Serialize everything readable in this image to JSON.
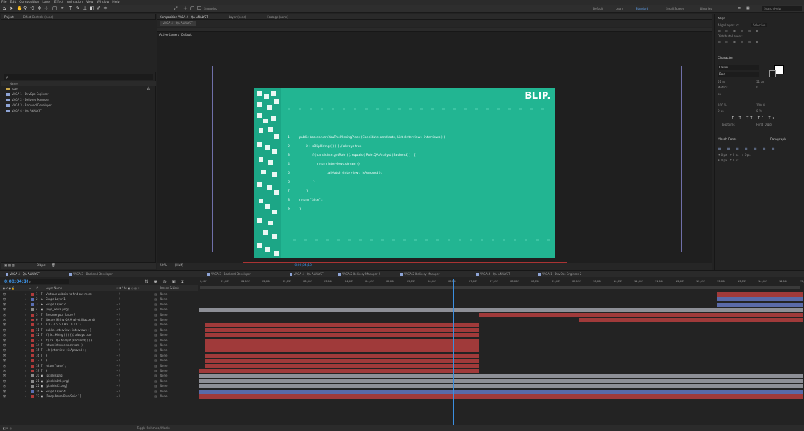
{
  "menu": [
    "File",
    "Edit",
    "Composition",
    "Layer",
    "Effect",
    "Animation",
    "View",
    "Window",
    "Help"
  ],
  "toolbar": {
    "snapping_label": "Snapping",
    "workspaces": [
      "Default",
      "Learn",
      "Standard",
      "Small Screen",
      "Libraries"
    ],
    "active_workspace": "Standard",
    "search_placeholder": "Search Help"
  },
  "project_panel": {
    "tabs": [
      "Project",
      "Effect Controls (none)"
    ],
    "search_placeholder": "ρ",
    "column_name": "Name",
    "items": [
      "logo",
      "VAGA 1 - DevOps Engineer",
      "VAGA 2 - Delivery Manager",
      "VAGA 3 - Backend Developer",
      "VAGA 4 - QA ANALYST"
    ],
    "footer_bpc": "8 bpc"
  },
  "composition_panel": {
    "tab_label": "Composition VAGA 4 - QA ANALYST",
    "layer_tab": "Layer (none)",
    "footage_tab": "Footage (none)",
    "sub_tab": "VAGA 4 - QA ANALYST",
    "active_camera": "Active Camera (Default)",
    "footer": {
      "zoom": "50%",
      "resolution": "(Half)",
      "timecode": "0;00;04;10"
    },
    "artwork": {
      "brand": "BLIP.",
      "background": "#22b592",
      "code_lines": [
        "public boolean areYouTheMissingPiece (Candidate candidate, List<Interview> interviews ) {",
        "if ( isBlipHiring ( ) )  { // always true",
        "if ( candidate.getRole ( ). equals ( Role.QA Analyst (Backend) ) ) {",
        "return interviews.stream ()",
        ".allMatch (Interview :: isAproved ) ;",
        "}",
        "}",
        "return \"false\" ;",
        "}"
      ],
      "line_numbers": [
        "1",
        "2",
        "3",
        "4",
        "5",
        "6",
        "7",
        "8",
        "9"
      ]
    }
  },
  "right_panels": {
    "align_title": "Align",
    "align_to_label": "Align Layers to:",
    "align_to_value": "Selection",
    "distribute_label": "Distribute Layers:",
    "character_title": "Character",
    "font_name": "Calibri",
    "font_style": "Bold",
    "font_size": "51 px",
    "leading": "51 px",
    "kerning": "Metrics",
    "tracking": "0",
    "stroke": "px",
    "scale_v": "100 %",
    "scale_h": "100 %",
    "baseline": "0 px",
    "tsume": "0 %",
    "ligatures": "Ligatures",
    "hindi_digits": "Hindi Digits",
    "paragraph_title": "Paragraph",
    "match_font": "Match Fonts"
  },
  "timeline": {
    "tabs": [
      "VAGA 4 - QA ANALYST",
      "VAGA 3 - Backend Developer",
      "VAGA 3 - Backend Developer",
      "VAGA 4 - QA ANALYST",
      "VAGA 2 Delivery Manager 2",
      "VAGA 2 Delivery Manager",
      "VAGA 4 - QA ANALYST",
      "VAGA 1 - DevOps Engineer 2"
    ],
    "current_time": "0;00;04;10",
    "search_placeholder": "ρ",
    "col_layer_name": "Layer Name",
    "col_switches": "✠ ✱ \\ fx ▣ ○ ◎ ✳",
    "col_parent": "Parent & Link",
    "ruler_ticks": [
      "0;00f",
      "01;00f",
      "01;15f",
      "02;00f",
      "02;15f",
      "03;00f",
      "03;15f",
      "04;00f",
      "04;15f",
      "05;00f",
      "05;15f",
      "06;00f",
      "06;15f",
      "07;00f",
      "07;15f",
      "08;00f",
      "08;15f",
      "09;00f",
      "09;15f",
      "10;00f",
      "10;15f",
      "11;00f",
      "11;15f",
      "12;00f",
      "12;15f",
      "13;00f",
      "13;15f",
      "14;00f",
      "14;15f",
      "15;00"
    ],
    "layers": [
      {
        "num": "1",
        "type": "T",
        "name": "Visit our website to find out more",
        "parent": "None",
        "color": "#b03a3a"
      },
      {
        "num": "2",
        "type": "★",
        "name": "Shape Layer 1",
        "parent": "None",
        "color": "#5a6fb3"
      },
      {
        "num": "3",
        "type": "★",
        "name": "Shape Layer 2",
        "parent": "None",
        "color": "#5a6fb3"
      },
      {
        "num": "4",
        "type": "▣",
        "name": "[logo_white.png]",
        "parent": "None",
        "color": "#8a8a8a"
      },
      {
        "num": "5",
        "type": "T",
        "name": "Become your future ?",
        "parent": "None",
        "color": "#b03a3a"
      },
      {
        "num": "6",
        "type": "T",
        "name": "We are Hiring QA Analyst (Backend)",
        "parent": "None",
        "color": "#b03a3a"
      },
      {
        "num": "10",
        "type": "T",
        "name": "1 2 3 4 5 6 7 8 9 10 11 12",
        "parent": "None",
        "color": "#b03a3a"
      },
      {
        "num": "11",
        "type": "T",
        "name": "public...Interview> interviews ) {",
        "parent": "None",
        "color": "#b03a3a"
      },
      {
        "num": "12",
        "type": "T",
        "name": "if ( is...Hiring ( ) )  { // always true",
        "parent": "None",
        "color": "#b03a3a"
      },
      {
        "num": "13",
        "type": "T",
        "name": "if ( ca...QA Analyst (Backend) ) ) {",
        "parent": "None",
        "color": "#b03a3a"
      },
      {
        "num": "14",
        "type": "T",
        "name": "return interviews.stream ()",
        "parent": "None",
        "color": "#b03a3a"
      },
      {
        "num": "15",
        "type": "T",
        "name": "...h (Interview :: isAproved ) ;",
        "parent": "None",
        "color": "#b03a3a"
      },
      {
        "num": "16",
        "type": "T",
        "name": "}",
        "parent": "None",
        "color": "#b03a3a"
      },
      {
        "num": "17",
        "type": "T",
        "name": "}",
        "parent": "None",
        "color": "#b03a3a"
      },
      {
        "num": "18",
        "type": "T",
        "name": "return \"false\" ;",
        "parent": "None",
        "color": "#b03a3a"
      },
      {
        "num": "19",
        "type": "T",
        "name": "}",
        "parent": "None",
        "color": "#b03a3a"
      },
      {
        "num": "20",
        "type": "▣",
        "name": "[pixelds.png]",
        "parent": "None",
        "color": "#8a8a8a"
      },
      {
        "num": "21",
        "type": "▣",
        "name": "[pixelds400.png]",
        "parent": "None",
        "color": "#8a8a8a"
      },
      {
        "num": "22",
        "type": "▣",
        "name": "[pixelds02.png]",
        "parent": "None",
        "color": "#8a8a8a"
      },
      {
        "num": "26",
        "type": "★",
        "name": "Shape Layer 4",
        "parent": "None",
        "color": "#5a6fb3"
      },
      {
        "num": "27",
        "type": "▣",
        "name": "[Deep Azure Blue Solid 1]",
        "parent": "None",
        "color": "#b03a3a"
      }
    ],
    "status": "Toggle Switches / Modes"
  }
}
